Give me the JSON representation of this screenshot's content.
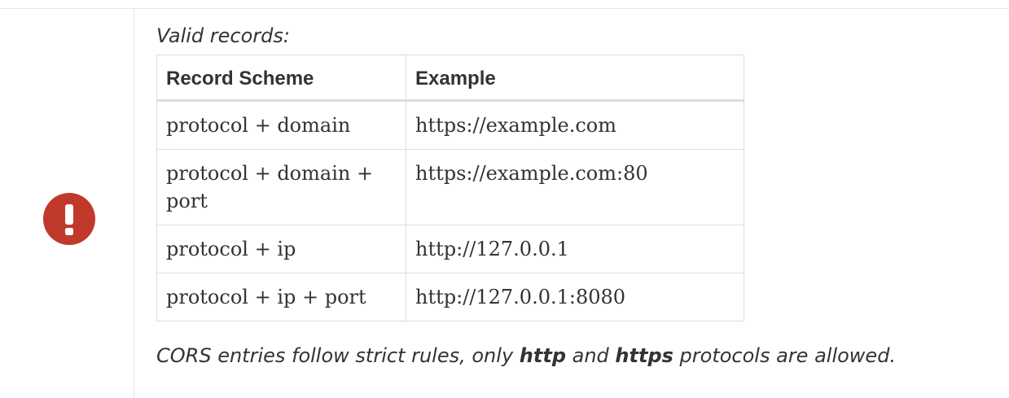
{
  "admonition": {
    "icon": "exclamation-icon",
    "icon_color": "#c0392b",
    "intro": "Valid records:",
    "table": {
      "headers": [
        "Record Scheme",
        "Example"
      ],
      "rows": [
        [
          "protocol + domain",
          "https://example.com"
        ],
        [
          "protocol + domain + port",
          "https://example.com:80"
        ],
        [
          "protocol + ip",
          "http://127.0.0.1"
        ],
        [
          "protocol + ip + port",
          "http://127.0.0.1:8080"
        ]
      ]
    },
    "footnote": {
      "before": "CORS entries follow strict rules, only ",
      "http": "http",
      "middle": " and ",
      "https": "https",
      "after": " protocols are allowed."
    }
  }
}
